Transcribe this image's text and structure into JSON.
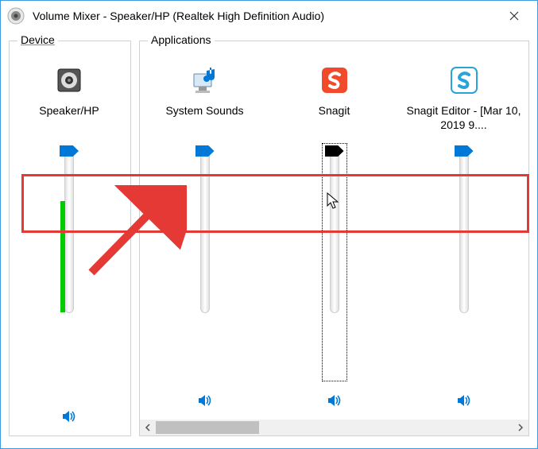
{
  "window": {
    "title": "Volume Mixer - Speaker/HP (Realtek High Definition Audio)"
  },
  "groups": {
    "device": "Device",
    "apps": "Applications"
  },
  "device": {
    "label": "Speaker/HP"
  },
  "apps": [
    {
      "label": "System Sounds"
    },
    {
      "label": "Snagit"
    },
    {
      "label": "Snagit Editor - [Mar 10, 2019 9...."
    }
  ],
  "icons": {
    "title": "speaker-app-icon",
    "close": "close-icon",
    "device": "speaker-device-icon",
    "system_sounds": "system-sounds-icon",
    "snagit": "snagit-icon",
    "snagit_editor": "snagit-editor-icon",
    "mute": "speaker-on-icon"
  }
}
